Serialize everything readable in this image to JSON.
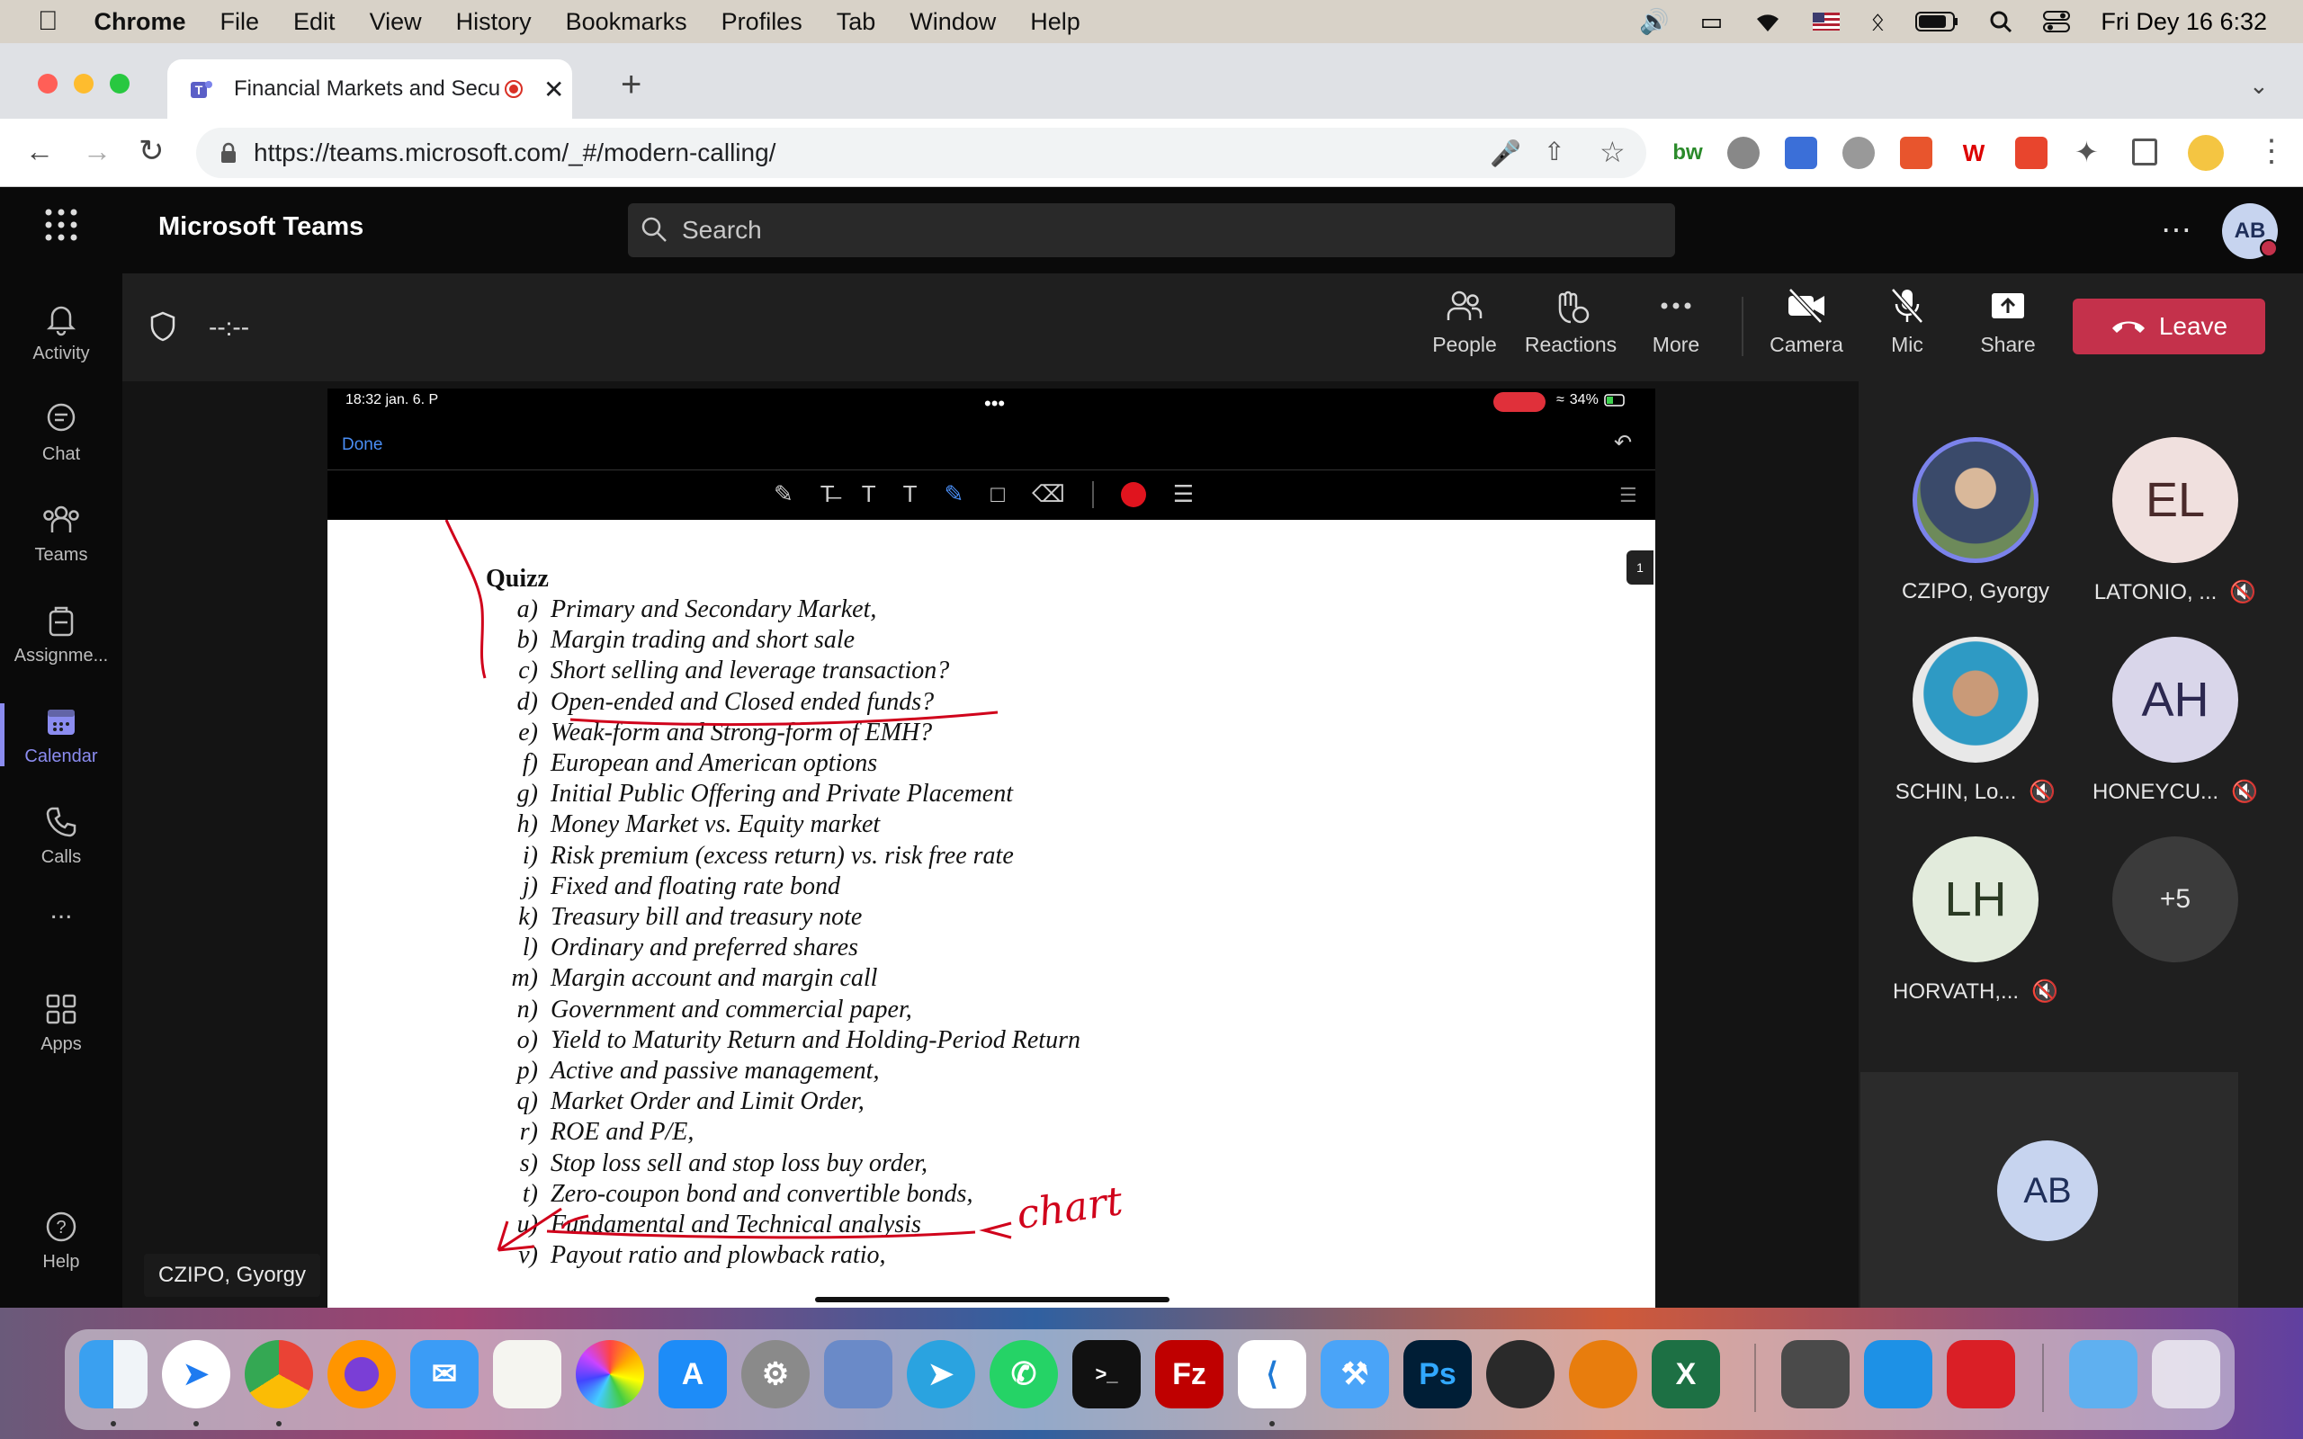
{
  "menubar": {
    "app": "Chrome",
    "items": [
      "File",
      "Edit",
      "View",
      "History",
      "Bookmarks",
      "Profiles",
      "Tab",
      "Window",
      "Help"
    ],
    "clock": "Fri Dey 16  6:32"
  },
  "browser": {
    "tab_title": "Financial Markets and Secu",
    "url": "https://teams.microsoft.com/_#/modern-calling/"
  },
  "teams": {
    "app_title": "Microsoft Teams",
    "search_placeholder": "Search",
    "user_initials": "AB",
    "rail": [
      {
        "label": "Activity",
        "icon": "bell-icon"
      },
      {
        "label": "Chat",
        "icon": "chat-icon"
      },
      {
        "label": "Teams",
        "icon": "teams-icon"
      },
      {
        "label": "Assignme...",
        "icon": "assignments-icon"
      },
      {
        "label": "Calendar",
        "icon": "calendar-icon",
        "active": true
      },
      {
        "label": "Calls",
        "icon": "phone-icon"
      },
      {
        "label": "...",
        "icon": "more-icon"
      },
      {
        "label": "Apps",
        "icon": "apps-icon"
      },
      {
        "label": "Help",
        "icon": "help-icon"
      }
    ],
    "call": {
      "timer": "--:--",
      "buttons": {
        "people": "People",
        "reactions": "Reactions",
        "more": "More",
        "camera": "Camera",
        "mic": "Mic",
        "share": "Share",
        "leave": "Leave"
      }
    },
    "presenter_tag": "CZIPO, Gyorgy"
  },
  "shared_screen": {
    "status_time": "18:32  jan. 6. P",
    "battery": "34%",
    "done_label": "Done",
    "page_number": "1",
    "quiz_title": "Quizz",
    "items": [
      {
        "letter": "a)",
        "text": "Primary and Secondary Market,"
      },
      {
        "letter": "b)",
        "text": "Margin trading and short sale"
      },
      {
        "letter": "c)",
        "text": "Short selling and leverage transaction?"
      },
      {
        "letter": "d)",
        "text": "Open-ended and Closed ended funds?"
      },
      {
        "letter": "e)",
        "text": "Weak-form and Strong-form of EMH?"
      },
      {
        "letter": "f)",
        "text": "European and American options"
      },
      {
        "letter": "g)",
        "text": "Initial Public Offering and Private Placement"
      },
      {
        "letter": "h)",
        "text": "Money Market vs. Equity market"
      },
      {
        "letter": "i)",
        "text": "Risk premium (excess return) vs. risk free rate"
      },
      {
        "letter": "j)",
        "text": "Fixed and floating rate bond"
      },
      {
        "letter": "k)",
        "text": "Treasury bill and treasury note"
      },
      {
        "letter": "l)",
        "text": "Ordinary and preferred shares"
      },
      {
        "letter": "m)",
        "text": "Margin account and margin call"
      },
      {
        "letter": "n)",
        "text": "Government and commercial paper,"
      },
      {
        "letter": "o)",
        "text": "Yield to Maturity Return and Holding-Period Return"
      },
      {
        "letter": "p)",
        "text": "Active and passive management,"
      },
      {
        "letter": "q)",
        "text": "Market Order and Limit Order,"
      },
      {
        "letter": "r)",
        "text": "ROE and P/E,"
      },
      {
        "letter": "s)",
        "text": "Stop loss sell and stop loss buy order,"
      },
      {
        "letter": "t)",
        "text": "Zero-coupon bond and convertible bonds,"
      },
      {
        "letter": "u)",
        "text": "Fundamental and Technical analysis"
      },
      {
        "letter": "v)",
        "text": "Payout ratio and plowback ratio,"
      }
    ],
    "handwritten_note": "chart"
  },
  "participants": [
    {
      "name": "CZIPO, Gyorgy",
      "initials": "",
      "muted": false,
      "speaking": true
    },
    {
      "name": "LATONIO, ...",
      "initials": "EL",
      "muted": true
    },
    {
      "name": "SCHIN, Lo...",
      "initials": "",
      "muted": true
    },
    {
      "name": "HONEYCU...",
      "initials": "AH",
      "muted": true
    },
    {
      "name": "HORVATH,...",
      "initials": "LH",
      "muted": true
    },
    {
      "name": "",
      "initials": "+5",
      "muted": false
    }
  ],
  "self_view": {
    "initials": "AB"
  },
  "colors": {
    "accent": "#8b8cf0",
    "leave": "#c4314b",
    "ink": "#d0021b"
  }
}
